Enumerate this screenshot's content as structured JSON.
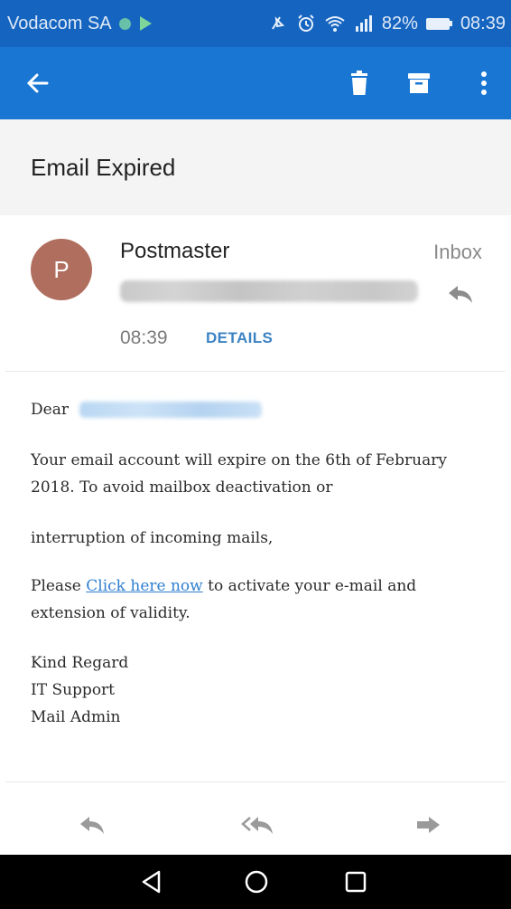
{
  "status_bar": {
    "carrier": "Vodacom SA",
    "battery": "82%",
    "time": "08:39",
    "icons": [
      "notification-dot-icon",
      "play-icon",
      "mute-icon",
      "alarm-icon",
      "wifi-icon",
      "signal-icon",
      "battery-icon"
    ]
  },
  "app_bar": {
    "color": "#1976d2",
    "actions": [
      "back-arrow-icon",
      "delete-icon",
      "archive-icon",
      "more-options-icon"
    ]
  },
  "email": {
    "subject": "Email Expired",
    "avatar_letter": "P",
    "avatar_color": "#b06e5e",
    "sender": "Postmaster",
    "folder": "Inbox",
    "time": "08:39",
    "details_label": "DETAILS",
    "greeting": "Dear",
    "paragraph1": "Your email account will expire on the 6th of February 2018. To avoid mailbox deactivation or",
    "paragraph2": "interruption of incoming mails,",
    "paragraph3_before": "Please ",
    "paragraph3_link": "Click here now",
    "paragraph3_after": " to activate your e-mail and extension of validity.",
    "signature": {
      "line1": "Kind Regard",
      "line2": "IT Support",
      "line3": "Mail Admin"
    }
  },
  "bottom_actions": [
    "reply-icon",
    "reply-all-icon",
    "forward-icon"
  ],
  "nav_bar": [
    "back-triangle-icon",
    "home-circle-icon",
    "recents-square-icon"
  ]
}
